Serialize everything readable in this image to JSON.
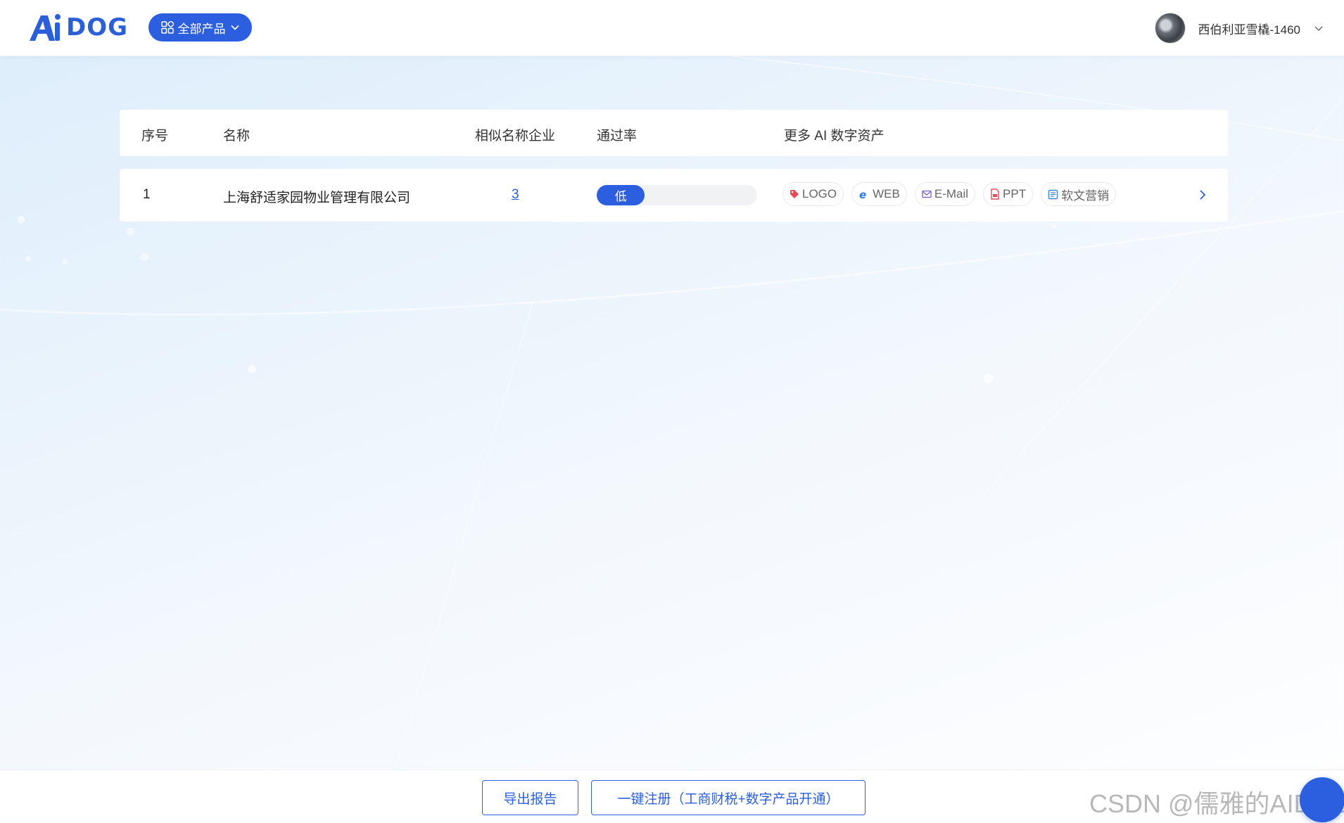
{
  "header": {
    "logo_text": "DOG",
    "products_button_label": "全部产品",
    "user_name": "西伯利亚雪橇-1460"
  },
  "table": {
    "columns": [
      "序号",
      "名称",
      "相似名称企业",
      "通过率",
      "更多 AI 数字资产"
    ],
    "rows": [
      {
        "index": "1",
        "name": "上海舒适家园物业管理有限公司",
        "similar_count": "3",
        "pass_rate_label": "低",
        "pass_rate_level": 0.3,
        "assets": [
          "LOGO",
          "WEB",
          "E-Mail",
          "PPT",
          "软文营销"
        ]
      }
    ]
  },
  "footer": {
    "export_label": "导出报告",
    "register_label": "一键注册（工商财税+数字产品开通）"
  },
  "watermark": "CSDN @儒雅的AIDOG",
  "colors": {
    "primary": "#2c5fe0",
    "logo": "#2b5fd9"
  },
  "icons": [
    "grid-icon",
    "chevron-down-icon",
    "tag-icon",
    "web-icon",
    "mail-icon",
    "pdf-icon",
    "doc-icon",
    "chevron-right-icon"
  ]
}
